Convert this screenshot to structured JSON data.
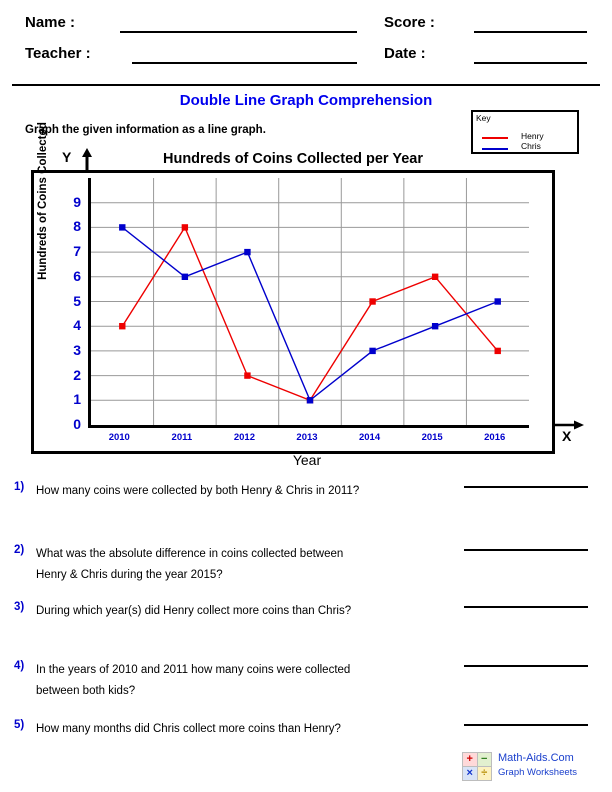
{
  "header": {
    "name_label": "Name :",
    "teacher_label": "Teacher :",
    "score_label": "Score :",
    "date_label": "Date :",
    "name_value": "",
    "teacher_value": "",
    "score_value": "",
    "date_value": ""
  },
  "worksheet": {
    "title": "Double Line Graph Comprehension",
    "instruction": "Graph the given information as a line graph.",
    "title_color": "#0000ee"
  },
  "key": {
    "title": "Key",
    "entries": [
      {
        "label": "Henry",
        "color": "#ee0000"
      },
      {
        "label": "Chris",
        "color": "#0000cc"
      }
    ]
  },
  "axis_markers": {
    "y_letter": "Y",
    "x_letter": "X"
  },
  "chart_data": {
    "type": "line",
    "title": "Hundreds of Coins Collected per Year",
    "xlabel": "Year",
    "ylabel": "Hundreds of Coins Collected",
    "categories": [
      "2010",
      "2011",
      "2012",
      "2013",
      "2014",
      "2015",
      "2016"
    ],
    "ylim": [
      0,
      10
    ],
    "yticks": [
      "0",
      "1",
      "2",
      "3",
      "4",
      "5",
      "6",
      "7",
      "8",
      "9"
    ],
    "grid": true,
    "legend_position": "top-right",
    "series": [
      {
        "name": "Henry",
        "color": "#ee0000",
        "values": [
          4,
          8,
          2,
          1,
          5,
          6,
          3
        ]
      },
      {
        "name": "Chris",
        "color": "#0000cc",
        "values": [
          8,
          6,
          7,
          1,
          3,
          4,
          5
        ]
      }
    ]
  },
  "questions": [
    {
      "number": "1)",
      "lines": [
        "How many coins were collected by both Henry & Chris in 2011?"
      ]
    },
    {
      "number": "2)",
      "lines": [
        "What was the absolute difference in coins collected between",
        "Henry & Chris during the year 2015?"
      ]
    },
    {
      "number": "3)",
      "lines": [
        "During which year(s) did Henry collect more coins than Chris?"
      ]
    },
    {
      "number": "4)",
      "lines": [
        "In the years of 2010 and 2011 how many coins were collected",
        "between both kids?"
      ]
    },
    {
      "number": "5)",
      "lines": [
        "How many months did Chris collect more coins than Henry?"
      ]
    }
  ],
  "footer": {
    "site_name": "Math-Aids.Com",
    "tagline": "Graph Worksheets",
    "logo_symbols": [
      "+",
      "−",
      "×",
      "÷"
    ]
  }
}
